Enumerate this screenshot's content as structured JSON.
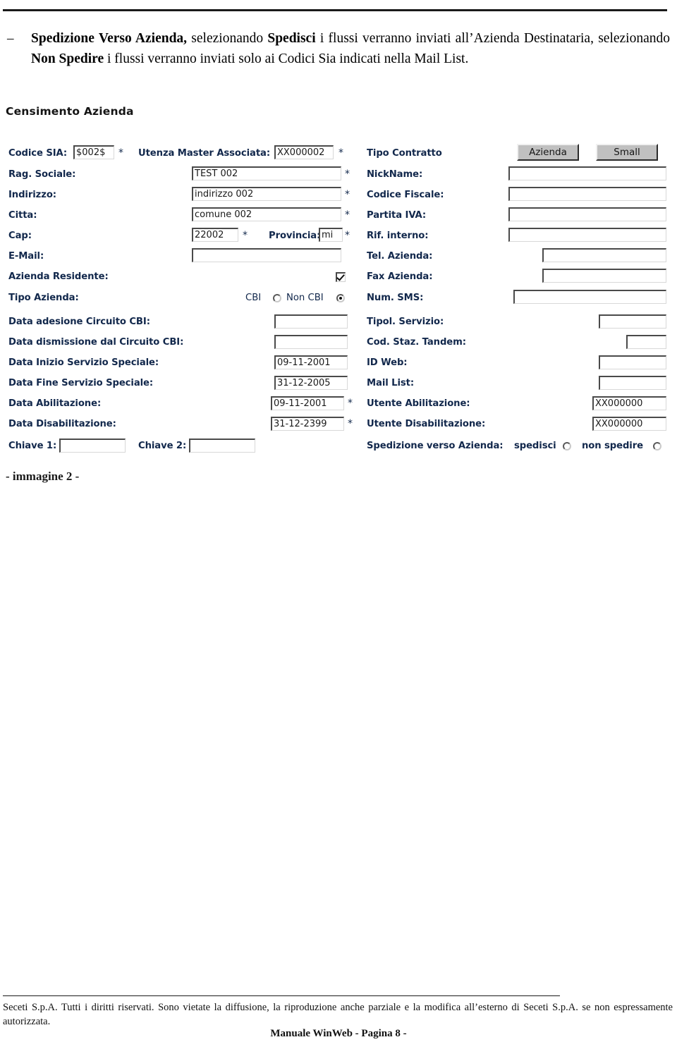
{
  "intro": {
    "bullet": "–",
    "seg1_bold": "Spedizione Verso Azienda,",
    "seg2": " selezionando ",
    "seg3_bold": "Spedisci",
    "seg4": " i flussi verranno inviati all’Azienda Destinataria, selezionando ",
    "seg5_bold": "Non Spedire",
    "seg6": " i flussi verranno inviati solo ai Codici Sia indicati nella Mail List."
  },
  "form": {
    "title": "Censimento Azienda",
    "left_column": {
      "codice_sia": {
        "label": "Codice SIA:",
        "value": "$002$",
        "required": "*"
      },
      "rag_sociale": {
        "label": "Rag. Sociale:",
        "value": "TEST 002",
        "required": "*"
      },
      "indirizzo": {
        "label": "Indirizzo:",
        "value": "indirizzo 002",
        "required": "*"
      },
      "citta": {
        "label": "Citta:",
        "value": "comune 002",
        "required": "*"
      },
      "cap": {
        "label": "Cap:",
        "value": "22002",
        "required": "*"
      },
      "provincia": {
        "label": "Provincia:",
        "value": "mi",
        "required": "*"
      },
      "email": {
        "label": "E-Mail:",
        "value": ""
      },
      "azienda_residente": {
        "label": "Azienda Residente:",
        "checked": true
      },
      "tipo_azienda": {
        "label": "Tipo Azienda:",
        "option_cbi": "CBI",
        "option_non_cbi": "Non CBI",
        "selected": "Non CBI"
      },
      "data_adesione_cbi": {
        "label": "Data adesione Circuito CBI:",
        "value": ""
      },
      "data_dismissione_cbi": {
        "label": "Data dismissione dal Circuito CBI:",
        "value": ""
      },
      "data_inizio_servizio": {
        "label": "Data Inizio Servizio Speciale:",
        "value": "09-11-2001"
      },
      "data_fine_servizio": {
        "label": "Data Fine Servizio Speciale:",
        "value": "31-12-2005"
      },
      "data_abilitazione": {
        "label": "Data Abilitazione:",
        "value": "09-11-2001",
        "required": "*"
      },
      "data_disabilitazione": {
        "label": "Data Disabilitazione:",
        "value": "31-12-2399",
        "required": "*"
      },
      "chiave1": {
        "label": "Chiave 1:",
        "value": ""
      },
      "chiave2": {
        "label": "Chiave 2:",
        "value": ""
      }
    },
    "top_fields": {
      "utenza_master": {
        "label": "Utenza Master Associata:",
        "value": "XX000002",
        "required": "*"
      }
    },
    "right_column": {
      "tipo_contratto": {
        "label": "Tipo Contratto",
        "button_azienda": "Azienda",
        "button_small": "Small"
      },
      "nickname": {
        "label": "NickName:",
        "value": ""
      },
      "codice_fiscale": {
        "label": "Codice Fiscale:",
        "value": ""
      },
      "partita_iva": {
        "label": "Partita IVA:",
        "value": ""
      },
      "rif_interno": {
        "label": "Rif. interno:",
        "value": ""
      },
      "tel_azienda": {
        "label": "Tel. Azienda:",
        "value": ""
      },
      "fax_azienda": {
        "label": "Fax Azienda:",
        "value": ""
      },
      "num_sms": {
        "label": "Num. SMS:",
        "value": ""
      },
      "tipol_servizio": {
        "label": "Tipol. Servizio:",
        "value": ""
      },
      "cod_staz_tandem": {
        "label": "Cod. Staz. Tandem:",
        "value": ""
      },
      "id_web": {
        "label": "ID Web:",
        "value": ""
      },
      "mail_list": {
        "label": "Mail List:",
        "value": ""
      },
      "utente_abilitazione": {
        "label": "Utente Abilitazione:",
        "value": "XX000000"
      },
      "utente_disabilitazione": {
        "label": "Utente Disabilitazione:",
        "value": "XX000000"
      },
      "spedizione": {
        "label": "Spedizione verso Azienda:",
        "option_spedisci": "spedisci",
        "option_non_spedire": "non spedire",
        "selected": ""
      }
    }
  },
  "caption": "- immagine 2 -",
  "footer": {
    "copyright": "Seceti S.p.A.  Tutti i diritti riservati.  Sono vietate la diffusione, la riproduzione anche parziale e la modifica all’esterno di Seceti S.p.A.  se non espressamente autorizzata.",
    "page": "Manuale WinWeb - Pagina 8 -"
  },
  "colors": {
    "label": "#12284c",
    "button_face": "#c0c0c0",
    "text": "#000000"
  }
}
